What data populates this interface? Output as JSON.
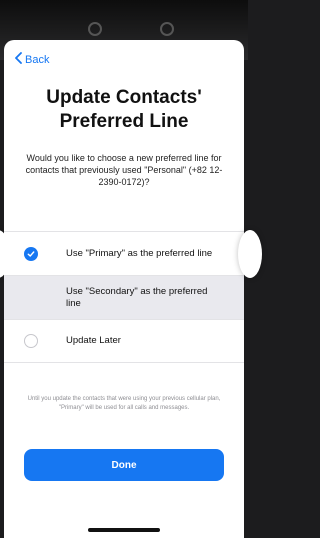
{
  "nav": {
    "back_label": "Back"
  },
  "header": {
    "title_line1": "Update Contacts'",
    "title_line2": "Preferred Line",
    "subtitle": "Would you like to choose a new preferred line for contacts that previously used \"Personal\" (+82 12-2390-0172)?"
  },
  "options": [
    {
      "label": "Use \"Primary\" as the preferred line",
      "selected": true
    },
    {
      "label": "Use \"Secondary\" as the preferred line",
      "selected": false
    },
    {
      "label": "Update Later",
      "selected": false
    }
  ],
  "footnote": "Until you update the contacts that were using your previous cellular plan, \"Primary\" will be used for all calls and messages.",
  "done_label": "Done",
  "colors": {
    "accent": "#1677f2",
    "highlight": "#e9e9ee"
  },
  "icons": {
    "back": "chevron-left-icon",
    "selected": "checkmark-icon"
  }
}
